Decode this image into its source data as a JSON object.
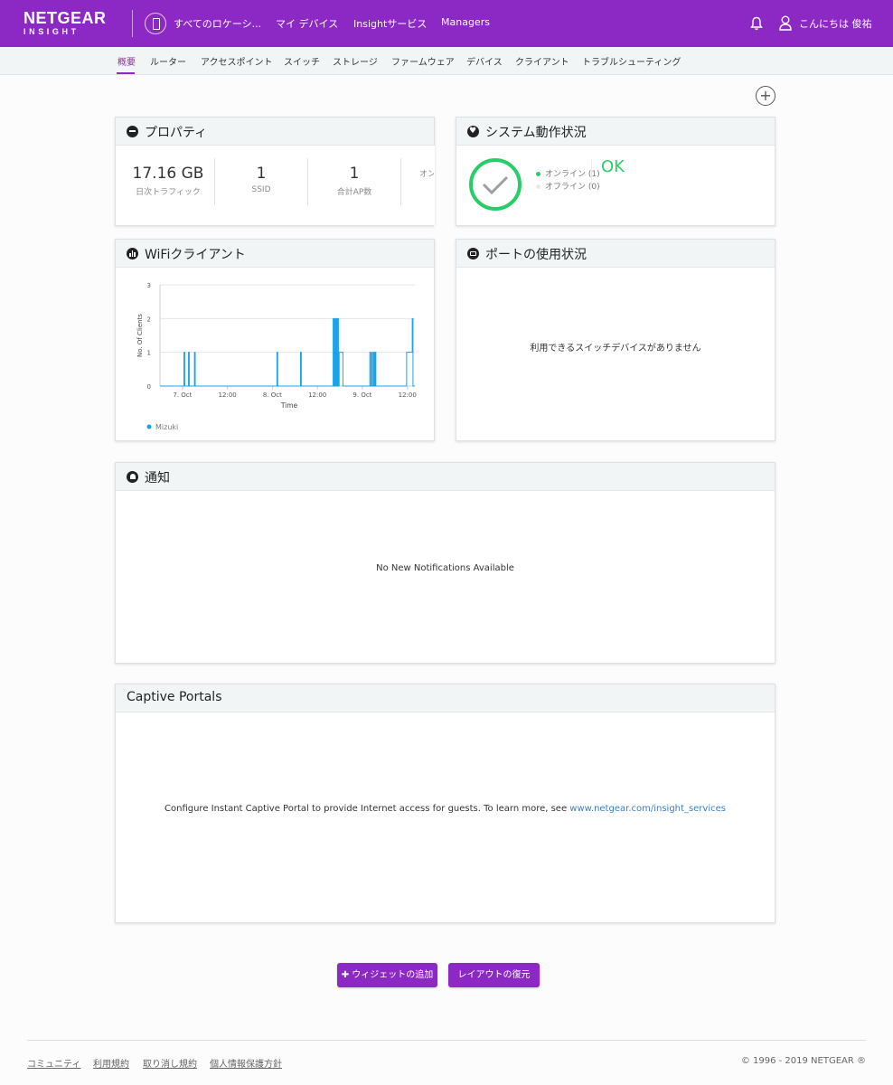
{
  "brand": {
    "line1": "NETGEAR",
    "line2": "INSIGHT"
  },
  "topnav": {
    "location": "すべてのロケーシ...",
    "my_devices": "マイ デバイス",
    "insight_services": "Insightサービス",
    "managers": "Managers",
    "greeting": "こんにちは 俊祐"
  },
  "subnav": {
    "items": [
      "概要",
      "ルーター",
      "アクセスポイント",
      "スイッチ",
      "ストレージ",
      "ファームウェア",
      "デバイス",
      "クライアント",
      "トラブルシューティング"
    ],
    "active_index": 0
  },
  "properties": {
    "title": "プロパティ",
    "cells": [
      {
        "value": "17.16 GB",
        "label": "日次トラフィック"
      },
      {
        "value": "1",
        "label": "SSID"
      },
      {
        "value": "1",
        "label": "合計AP数"
      },
      {
        "value": "",
        "label": "オン"
      }
    ]
  },
  "system_health": {
    "title": "システム動作状況",
    "online": "オンライン (1)",
    "offline": "オフライン (0)",
    "status": "OK",
    "online_color": "#27cd66",
    "offline_color": "#e8e8ee"
  },
  "wifi_clients": {
    "title": "WiFiクライアント",
    "legend": "Mizuki",
    "series_color": "#1aa3e8"
  },
  "chart_data": {
    "type": "line",
    "xlabel": "Time",
    "ylabel": "No. Of Clients",
    "ylim": [
      0,
      3
    ],
    "y_ticks": [
      0,
      1,
      2,
      3
    ],
    "x_ticks": [
      "7. Oct",
      "12:00",
      "8. Oct",
      "12:00",
      "9. Oct",
      "12:00"
    ],
    "x_unit": "hours since Oct 6 18:00",
    "xlim": [
      0,
      68
    ],
    "grid": true,
    "legend_position": "bottom-left",
    "series": [
      {
        "name": "Mizuki",
        "pulses": [
          {
            "start": 6.4,
            "end": 6.6,
            "value": 1
          },
          {
            "start": 7.6,
            "end": 7.8,
            "value": 1
          },
          {
            "start": 9.2,
            "end": 9.4,
            "value": 1
          },
          {
            "start": 31.2,
            "end": 31.4,
            "value": 1
          },
          {
            "start": 37.5,
            "end": 37.7,
            "value": 1
          },
          {
            "start": 46.2,
            "end": 46.4,
            "value": 2
          },
          {
            "start": 46.6,
            "end": 46.8,
            "value": 2
          },
          {
            "start": 47.0,
            "end": 47.2,
            "value": 2
          },
          {
            "start": 47.4,
            "end": 47.6,
            "value": 2
          },
          {
            "start": 47.8,
            "end": 48.8,
            "value": 1
          },
          {
            "start": 56.0,
            "end": 56.2,
            "value": 1
          },
          {
            "start": 56.5,
            "end": 56.7,
            "value": 1
          },
          {
            "start": 57.0,
            "end": 57.2,
            "value": 1
          },
          {
            "start": 57.4,
            "end": 57.6,
            "value": 1
          },
          {
            "start": 65.8,
            "end": 67.3,
            "value": 1
          },
          {
            "start": 67.3,
            "end": 67.5,
            "value": 2
          }
        ]
      }
    ]
  },
  "port_usage": {
    "title": "ポートの使用状況",
    "message": "利用できるスイッチデバイスがありません"
  },
  "notifications": {
    "title": "通知",
    "message": "No New Notifications Available"
  },
  "captive": {
    "title": "Captive Portals",
    "message": "Configure Instant Captive Portal to provide Internet access for guests. To learn more, see ",
    "link": "www.netgear.com/insight_services"
  },
  "actions": {
    "add_widget": "✚ ウィジェットの追加",
    "restore_layout": "レイアウトの復元"
  },
  "footer": {
    "links": [
      "コミュニティ",
      "利用規約",
      "取り消し規約",
      "個人情報保護方針"
    ],
    "copyright": "© 1996 - 2019 NETGEAR ®"
  }
}
